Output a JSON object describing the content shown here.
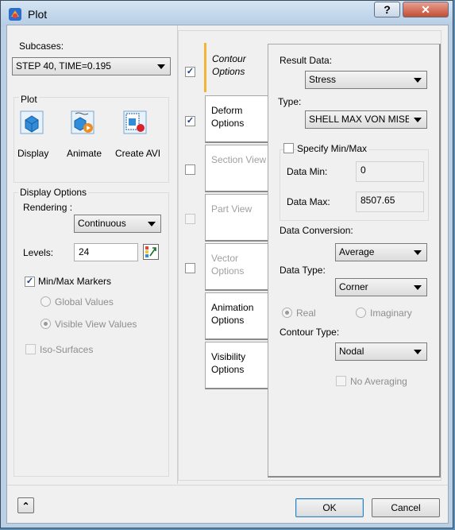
{
  "window": {
    "title": "Plot",
    "help_label": "?",
    "close_label": "✕"
  },
  "subcases": {
    "label": "Subcases:",
    "value": "STEP 40, TIME=0.195"
  },
  "plot": {
    "label": "Plot",
    "display_label": "Display",
    "animate_label": "Animate",
    "create_avi_label": "Create AVI"
  },
  "display_options": {
    "label": "Display Options",
    "rendering_label": "Rendering :",
    "rendering_value": "Continuous",
    "levels_label": "Levels:",
    "levels_value": "24",
    "minmax_label": "Min/Max Markers",
    "minmax_checked": true,
    "global_values_label": "Global Values",
    "visible_view_values_label": "Visible View Values",
    "iso_surfaces_label": "Iso-Surfaces"
  },
  "tabs": [
    {
      "label": "Contour Options",
      "checked": true,
      "enabled": true,
      "active": true
    },
    {
      "label": "Deform Options",
      "checked": true,
      "enabled": true
    },
    {
      "label": "Section View",
      "checked": false,
      "enabled": false
    },
    {
      "label": "Part View",
      "checked": false,
      "enabled": false
    },
    {
      "label": "Vector Options",
      "checked": false,
      "enabled": false
    },
    {
      "label": "Animation Options",
      "enabled": true
    },
    {
      "label": "Visibility Options",
      "enabled": true
    }
  ],
  "contour": {
    "result_data_label": "Result Data:",
    "result_data_value": "Stress",
    "type_label": "Type:",
    "type_value": "SHELL MAX VON MISES",
    "specify_minmax_label": "Specify Min/Max",
    "data_min_label": "Data Min:",
    "data_min_value": "0",
    "data_max_label": "Data Max:",
    "data_max_value": "8507.65",
    "data_conversion_label": "Data Conversion:",
    "data_conversion_value": "Average",
    "data_type_label": "Data Type:",
    "data_type_value": "Corner",
    "real_label": "Real",
    "imaginary_label": "Imaginary",
    "contour_type_label": "Contour Type:",
    "contour_type_value": "Nodal",
    "no_averaging_label": "No Averaging"
  },
  "footer": {
    "ok_label": "OK",
    "cancel_label": "Cancel",
    "expand_label": "⌃"
  },
  "colors": {
    "active_tab_accent": "#f5b335",
    "title_bar": "#c5daee",
    "close_button": "#c44d33"
  }
}
